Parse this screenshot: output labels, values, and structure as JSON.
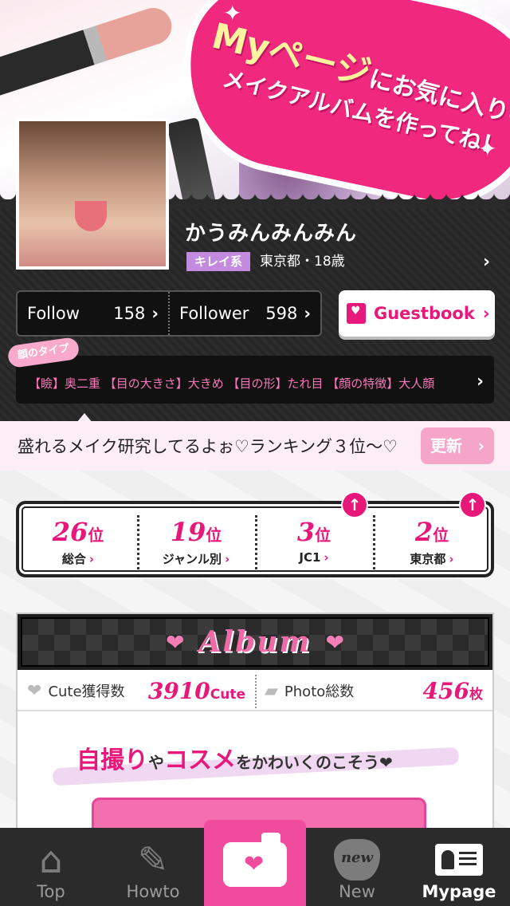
{
  "banner": {
    "headline_big": "Myページ",
    "headline_rest": "にお気に入りの",
    "headline_line2": "メイクアルバムを作ってね！"
  },
  "profile": {
    "username": "かうみんみんみん",
    "tag": "キレイ系",
    "location": "東京都・18歳",
    "follow_label": "Follow",
    "follow_count": "158",
    "follower_label": "Follower",
    "follower_count": "598",
    "guestbook_label": "Guestbook",
    "facetype_label": "顔のタイプ",
    "facetype_text": "【瞼】奥二重 【目の大きさ】大きめ 【目の形】たれ目 【顔の特徴】大人顔",
    "comment": "盛れるメイク研究してるよぉ♡ランキング３位〜♡",
    "update_label": "更新"
  },
  "ranking": [
    {
      "num": "26",
      "unit": "位",
      "label": "総合",
      "up": false
    },
    {
      "num": "19",
      "unit": "位",
      "label": "ジャンル別",
      "up": false
    },
    {
      "num": "3",
      "unit": "位",
      "label": "JC1",
      "up": true
    },
    {
      "num": "2",
      "unit": "位",
      "label": "東京都",
      "up": true
    }
  ],
  "album": {
    "title": "Album",
    "cute_label": "Cute獲得数",
    "cute_value": "3910",
    "cute_unit": "Cute",
    "photo_label": "Photo総数",
    "photo_value": "456",
    "photo_unit": "枚",
    "slogan_a": "自撮り",
    "slogan_b": "や",
    "slogan_c": "コスメ",
    "slogan_d": "をかわいくのこそう",
    "slogan_heart": "❤"
  },
  "tabs": [
    {
      "label": "Top",
      "icon": "house-heart-icon"
    },
    {
      "label": "Howto",
      "icon": "feather-icon"
    },
    {
      "label": "",
      "icon": "camera-heart-icon"
    },
    {
      "label": "New",
      "icon": "new-heart-icon"
    },
    {
      "label": "Mypage",
      "icon": "profile-card-icon"
    }
  ],
  "colors": {
    "accent": "#e8187a",
    "tab_bg": "#2b2b2b",
    "camera_bg": "#f04b9c",
    "tag_bg": "#c38adf"
  }
}
